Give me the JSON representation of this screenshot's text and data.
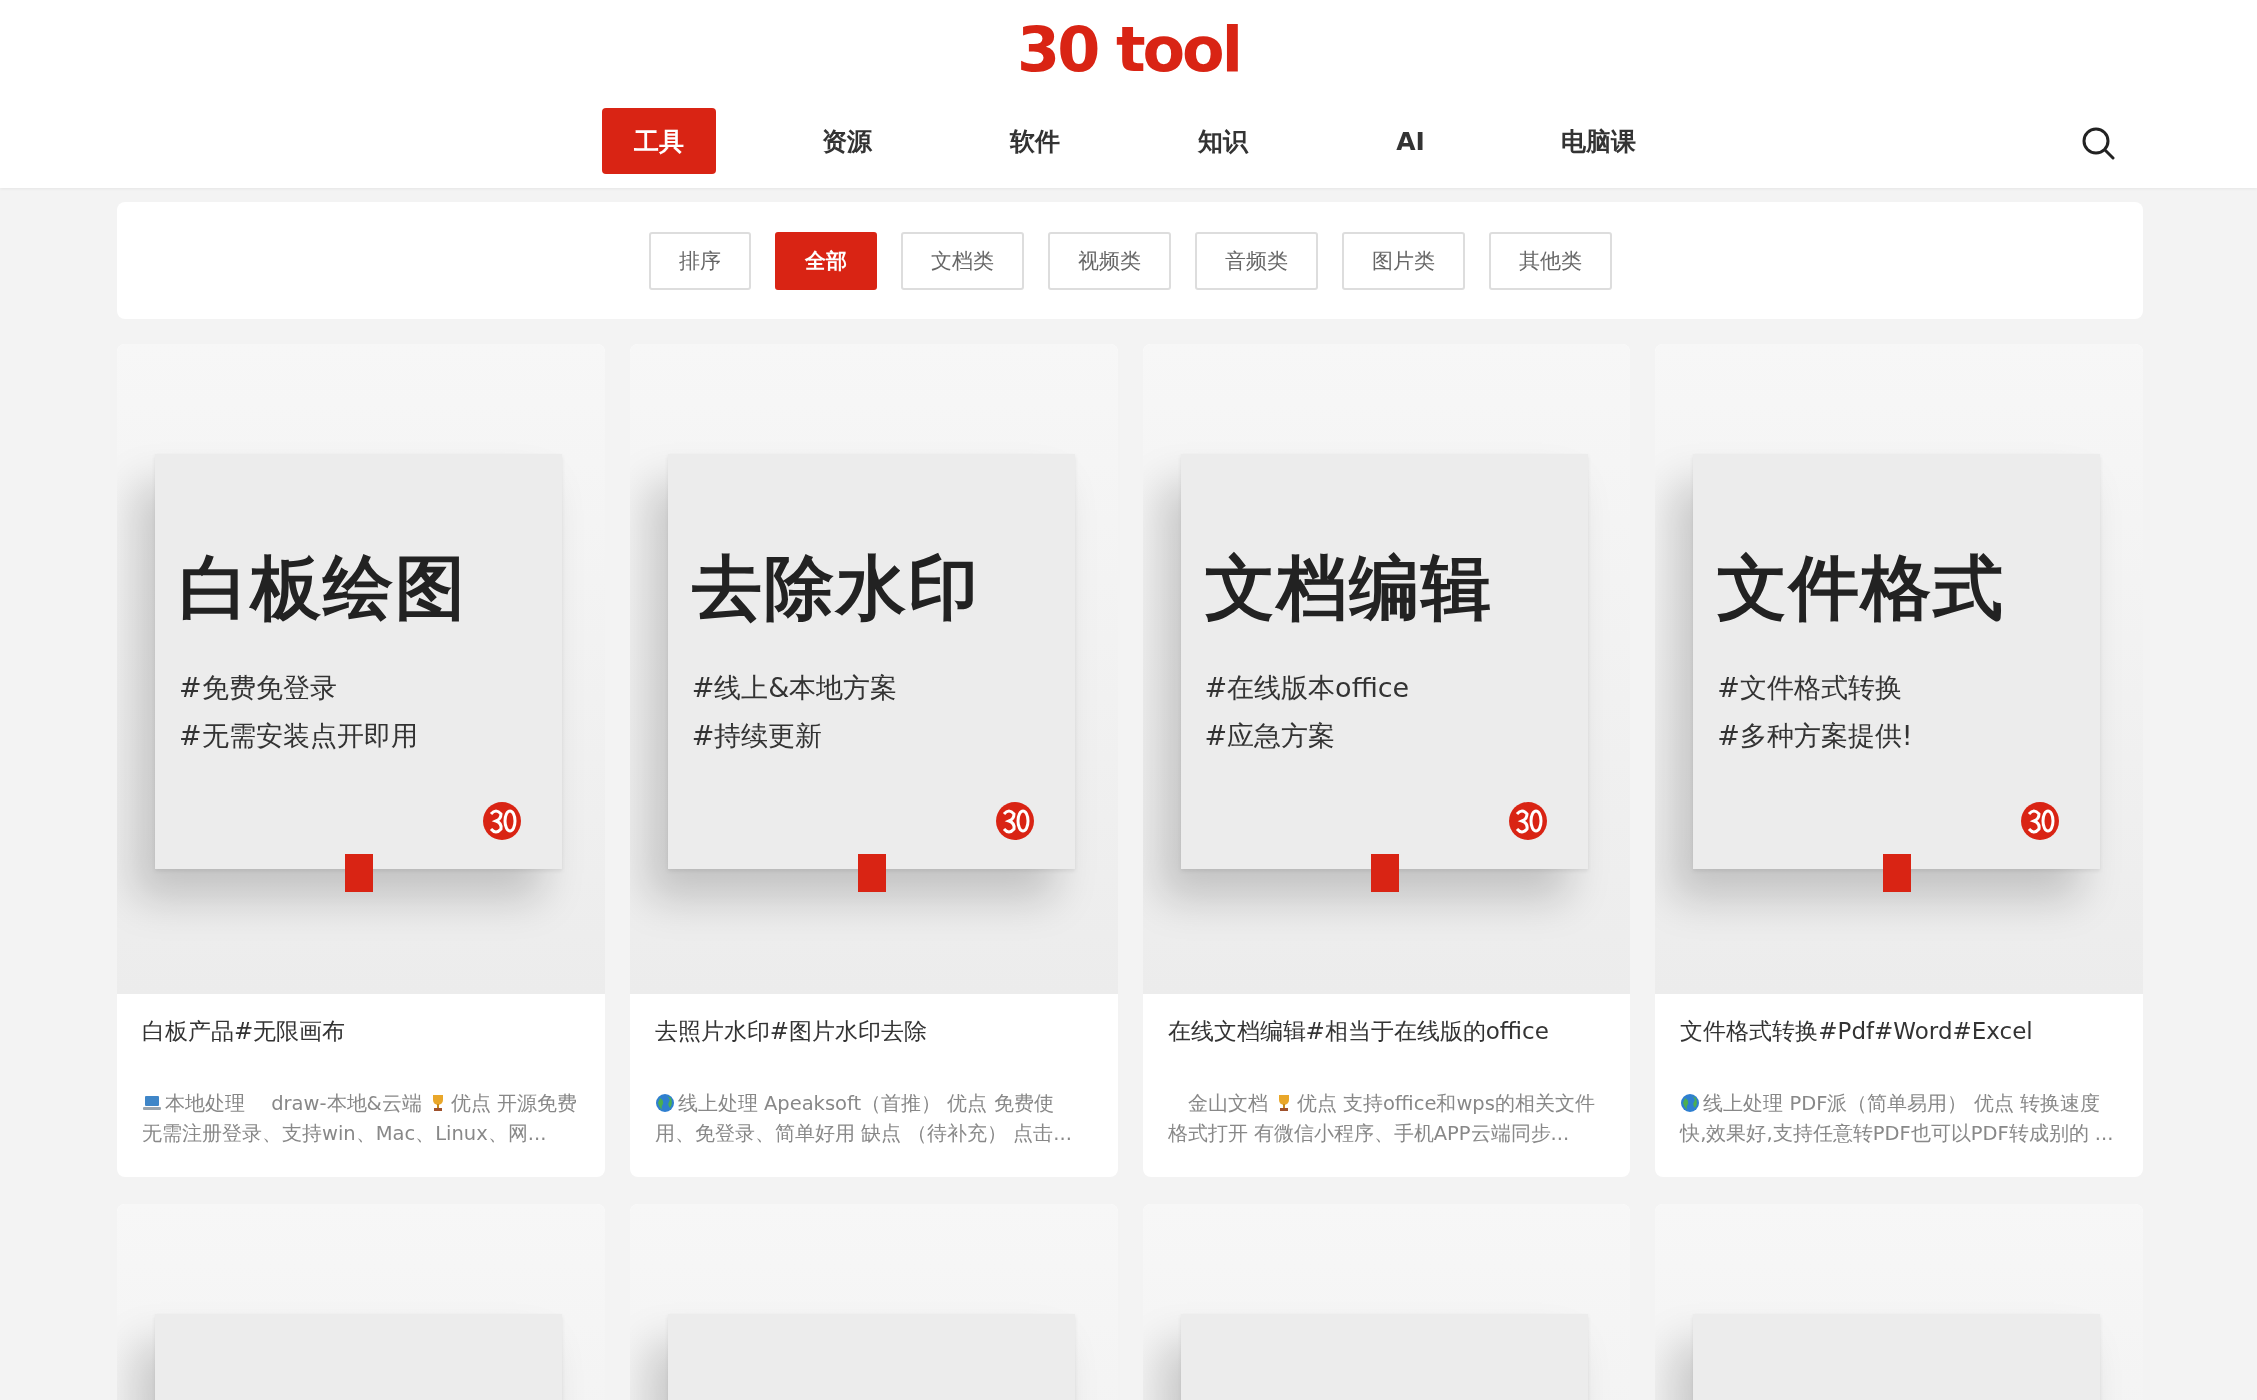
{
  "logo": "30 tool",
  "nav": [
    {
      "label": "工具",
      "selected": true
    },
    {
      "label": "资源",
      "selected": false
    },
    {
      "label": "软件",
      "selected": false
    },
    {
      "label": "知识",
      "selected": false
    },
    {
      "label": "AI",
      "selected": false
    },
    {
      "label": "电脑课",
      "selected": false
    }
  ],
  "filters": [
    {
      "label": "排序",
      "selected": false
    },
    {
      "label": "全部",
      "selected": true
    },
    {
      "label": "文档类",
      "selected": false
    },
    {
      "label": "视频类",
      "selected": false
    },
    {
      "label": "音频类",
      "selected": false
    },
    {
      "label": "图片类",
      "selected": false
    },
    {
      "label": "其他类",
      "selected": false
    }
  ],
  "cards": [
    {
      "cover_title": "白板绘图",
      "cover_tags": [
        "#免费免登录",
        "#无需安装点开即用"
      ],
      "title": "白板产品#无限画布",
      "description": [
        {
          "kind": "laptop"
        },
        {
          "kind": "text",
          "text": "本地处理　 draw-本地&云端 "
        },
        {
          "kind": "trophy"
        },
        {
          "kind": "text",
          "text": "优点 开源免费无需注册登录、支持win、Mac、Linux、网..."
        }
      ]
    },
    {
      "cover_title": "去除水印",
      "cover_tags": [
        "#线上&本地方案",
        "#持续更新"
      ],
      "title": "去照片水印#图片水印去除",
      "description": [
        {
          "kind": "globe"
        },
        {
          "kind": "text",
          "text": "线上处理 Apeaksoft（首推） 优点 免费使用、免登录、简单好用 缺点 （待补充） 点击..."
        }
      ]
    },
    {
      "cover_title": "文档编辑",
      "cover_tags": [
        "#在线版本office",
        "#应急方案"
      ],
      "title": "在线文档编辑#相当于在线版的office",
      "description": [
        {
          "kind": "text",
          "text": "　金山文档 "
        },
        {
          "kind": "trophy"
        },
        {
          "kind": "text",
          "text": "优点 支持office和wps的相关文件格式打开 有微信小程序、手机APP云端同步..."
        }
      ]
    },
    {
      "cover_title": "文件格式",
      "cover_tags": [
        "#文件格式转换",
        "#多种方案提供!"
      ],
      "title": "文件格式转换#Pdf#Word#Excel",
      "description": [
        {
          "kind": "globe"
        },
        {
          "kind": "text",
          "text": "线上处理 PDF派（简单易用） 优点 转换速度快,效果好,支持任意转PDF也可以PDF转成别的 ..."
        }
      ]
    }
  ],
  "more_cards": [
    {
      "kind": "cover"
    },
    {
      "kind": "cover"
    },
    {
      "kind": "cover"
    },
    {
      "kind": "cover"
    }
  ]
}
